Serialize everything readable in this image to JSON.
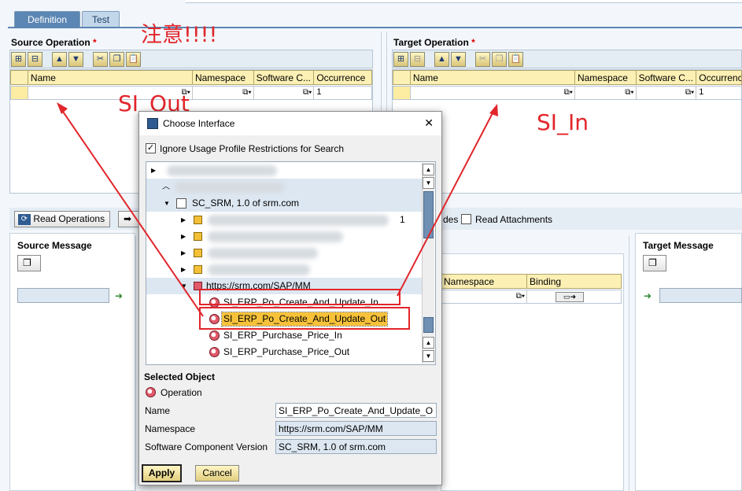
{
  "tabs": [
    {
      "label": "Definition"
    },
    {
      "label": "Test"
    }
  ],
  "annotations": {
    "note": "注意!!!!",
    "si_out": "SI_Out",
    "si_in": "SI_In"
  },
  "source_operation": {
    "title": "Source Operation",
    "required_mark": "*",
    "columns": [
      "Name",
      "Namespace",
      "Software C...",
      "Occurrence"
    ],
    "row": {
      "occurrence": "1"
    }
  },
  "target_operation": {
    "title": "Target Operation",
    "required_mark": "*",
    "columns": [
      "Name",
      "Namespace",
      "Software C...",
      "Occurrence"
    ],
    "row": {
      "occurrence": "1"
    }
  },
  "read_operations_label": "Read Operations",
  "modes_partial": "des",
  "read_attachments_label": "Read Attachments",
  "source_message_title": "Source Message",
  "target_message_title": "Target Message",
  "mapping_columns": [
    "Namespace",
    "Binding"
  ],
  "dialog": {
    "title": "Choose Interface",
    "ignore_checkbox": {
      "label": "Ignore Usage Profile Restrictions for Search",
      "checked": true
    },
    "tree": [
      {
        "label": "SC_SRM, 1.0 of srm.com",
        "type": "swcv"
      },
      {
        "label": "1",
        "type": "namespace-partial"
      },
      {
        "label": "https://srm.com/SAP/MM",
        "type": "namespace"
      },
      {
        "label": "SI_ERP_Po_Create_And_Update_In",
        "type": "operation"
      },
      {
        "label": "SI_ERP_Po_Create_And_Update_Out",
        "type": "operation",
        "selected": true
      },
      {
        "label": "SI_ERP_Purchase_Price_In",
        "type": "operation"
      },
      {
        "label": "SI_ERP_Purchase_Price_Out",
        "type": "operation"
      }
    ],
    "selected_object": {
      "title": "Selected Object",
      "kind": "Operation",
      "name_label": "Name",
      "name_value": "SI_ERP_Po_Create_And_Update_O",
      "namespace_label": "Namespace",
      "namespace_value": "https://srm.com/SAP/MM",
      "swcv_label": "Software Component Version",
      "swcv_value": "SC_SRM, 1.0 of srm.com"
    },
    "apply_label": "Apply",
    "cancel_label": "Cancel",
    "close_glyph": "✕"
  },
  "colors": {
    "accent": "#5c86b3",
    "highlight": "#f7c23a",
    "annotation": "#e1262b"
  }
}
